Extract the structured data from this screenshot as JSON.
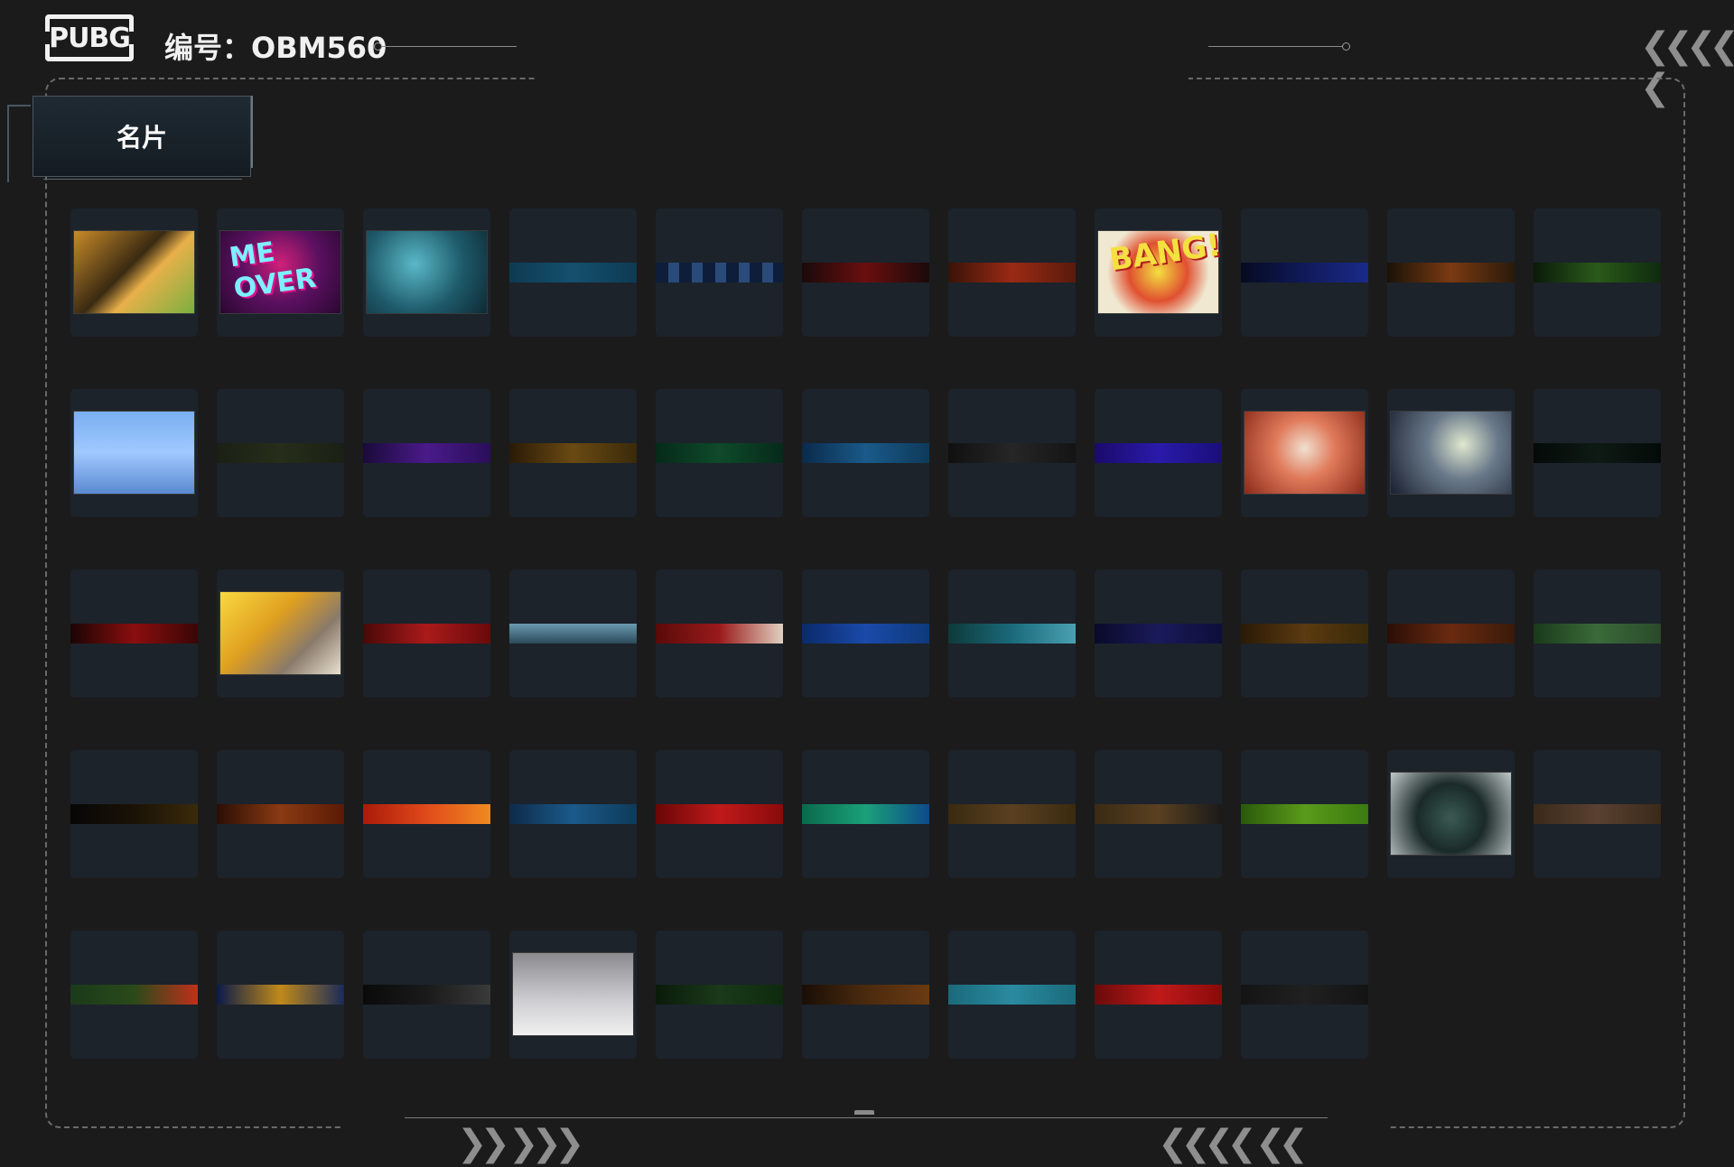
{
  "header": {
    "logo_text": "PUBG",
    "title": "编号：OBM560"
  },
  "tab": {
    "label": "名片"
  },
  "colors": {
    "background": "#1b1b1c",
    "card": "#1c232b",
    "frame": "#6a6a6a"
  },
  "cards": [
    {
      "kind": "art",
      "fill": "linear-gradient(135deg,#c98b2a,#3a2a12 45%,#e8b04a 60%,#7ab040)"
    },
    {
      "kind": "art",
      "fill": "radial-gradient(circle at 50% 40%,#d0207a,#5a1060 50%,#2a0830)",
      "label": "ME OVER"
    },
    {
      "kind": "art",
      "fill": "radial-gradient(circle at 40% 40%,#5ab8c8,#1e5a6a 55%,#0e2a34)"
    },
    {
      "kind": "strip",
      "fill": "linear-gradient(90deg,#0e3a52,#14506e,#0e3a52)"
    },
    {
      "kind": "strip",
      "fill": "repeating-linear-gradient(90deg,#0e1e3a 0 14px,#2a4a7a 14px 26px)"
    },
    {
      "kind": "strip",
      "fill": "linear-gradient(90deg,#1a0a0a,#6a0e0e,#1a0a0a)"
    },
    {
      "kind": "strip",
      "fill": "linear-gradient(90deg,#3a1208,#9a2a14,#5a1a0c)"
    },
    {
      "kind": "art",
      "fill": "radial-gradient(circle at 50% 50%,#f4e040,#e05030 40%,#f0e8d0 70%)",
      "label": "BANG!"
    },
    {
      "kind": "strip",
      "fill": "linear-gradient(90deg,#060a20,#101a5a,#1a2a8a)"
    },
    {
      "kind": "strip",
      "fill": "linear-gradient(90deg,#1a1208,#7a3a12,#2a1a0a)"
    },
    {
      "kind": "strip",
      "fill": "linear-gradient(90deg,#0a1a0a,#2a5a1a,#0e2a0e)"
    },
    {
      "kind": "art",
      "fill": "linear-gradient(180deg,#7ab0f0,#a0c8ff 50%,#5a8ad0)"
    },
    {
      "kind": "strip",
      "fill": "linear-gradient(90deg,#1a2014,#262e1a,#1a2014)"
    },
    {
      "kind": "strip",
      "fill": "linear-gradient(90deg,#1a0a3a,#4a1a8a,#2a0e5a)"
    },
    {
      "kind": "strip",
      "fill": "linear-gradient(90deg,#2a1a06,#6a4a12,#3a2a0a)"
    },
    {
      "kind": "strip",
      "fill": "linear-gradient(90deg,#062a1a,#0e4a2a,#062a1a)"
    },
    {
      "kind": "strip",
      "fill": "linear-gradient(90deg,#0a2a4a,#1a5a8a,#0e3a5a)"
    },
    {
      "kind": "strip",
      "fill": "linear-gradient(90deg,#101010,#262626,#141414)"
    },
    {
      "kind": "strip",
      "fill": "linear-gradient(90deg,#1a0a6a,#2a1aaa,#1a0e7a)"
    },
    {
      "kind": "art",
      "fill": "radial-gradient(circle at 50% 45%,#f0e0d0,#e07a5a 40%,#8a2a1a)"
    },
    {
      "kind": "art",
      "fill": "radial-gradient(circle at 60% 40%,#e0e8d0,#6a7a8a 40%,#1a2030)"
    },
    {
      "kind": "strip",
      "fill": "linear-gradient(90deg,#040a08,#0e1a14,#040a08)"
    },
    {
      "kind": "strip",
      "fill": "linear-gradient(90deg,#1a0404,#8a0e0e,#3a0606)"
    },
    {
      "kind": "art",
      "fill": "linear-gradient(135deg,#f8d840,#e0a020 40%,#8a7a6a 70%,#e8e0d0)"
    },
    {
      "kind": "strip",
      "fill": "linear-gradient(90deg,#4a0808,#aa1a1a,#6a0a0a)"
    },
    {
      "kind": "strip",
      "fill": "linear-gradient(180deg,#6a9ab0,#2a4a5a)"
    },
    {
      "kind": "strip",
      "fill": "linear-gradient(90deg,#5a0a0a,#9a1a1a,#e0d0c0)"
    },
    {
      "kind": "strip",
      "fill": "linear-gradient(90deg,#0a2a6a,#1a4aaa,#0e3a7a)"
    },
    {
      "kind": "strip",
      "fill": "linear-gradient(90deg,#0e3a3a,#1a6a7a,#4aa0b0)"
    },
    {
      "kind": "strip",
      "fill": "linear-gradient(90deg,#0a0a2a,#1a1a5a,#0e0e3a)"
    },
    {
      "kind": "strip",
      "fill": "linear-gradient(90deg,#2a1a06,#5a3a10,#3a2a0a)"
    },
    {
      "kind": "strip",
      "fill": "linear-gradient(90deg,#2a0e06,#6a2a10,#3a1a0a)"
    },
    {
      "kind": "strip",
      "fill": "linear-gradient(90deg,#1a3a1a,#3a6a3a,#2a4a2a)"
    },
    {
      "kind": "strip",
      "fill": "linear-gradient(90deg,#060606,#1a1206,#3a2a0a)"
    },
    {
      "kind": "strip",
      "fill": "linear-gradient(90deg,#2a0e04,#8a3a12,#5a1a06)"
    },
    {
      "kind": "strip",
      "fill": "linear-gradient(90deg,#aa1a0a,#e04a1a,#f08a20)"
    },
    {
      "kind": "strip",
      "fill": "linear-gradient(90deg,#0e2a4a,#1a5a8a,#0e3a5a)"
    },
    {
      "kind": "strip",
      "fill": "linear-gradient(90deg,#6a0606,#c01a1a,#8a0a0a)"
    },
    {
      "kind": "strip",
      "fill": "linear-gradient(90deg,#0a6a4a,#1aa07a,#0e4a8a)"
    },
    {
      "kind": "strip",
      "fill": "linear-gradient(90deg,#3a2a10,#5a4020,#3a2a10)"
    },
    {
      "kind": "strip",
      "fill": "linear-gradient(90deg,#3a2a14,#5a4020,#1a1a1a)"
    },
    {
      "kind": "strip",
      "fill": "linear-gradient(90deg,#2a5a0a,#5a9a1a,#3a7a10)"
    },
    {
      "kind": "art",
      "fill": "radial-gradient(circle at 50% 55%,#3a5a52,#1a2a28 45%,#c0c8c8)"
    },
    {
      "kind": "strip",
      "fill": "linear-gradient(90deg,#3a2a1a,#5a4030,#3a2a1a)"
    },
    {
      "kind": "strip",
      "fill": "linear-gradient(90deg,#1a3a1a,#2a4a1a,#c0301a)"
    },
    {
      "kind": "strip",
      "fill": "linear-gradient(90deg,#0a1a4a,#c08a1a,#1a2a5a)"
    },
    {
      "kind": "strip",
      "fill": "linear-gradient(90deg,#0a0a0a,#1a1a1a,#3a3a3a)"
    },
    {
      "kind": "art",
      "fill": "linear-gradient(180deg,#8a8a90,#d0d0d4 60%,#f0f0f0)"
    },
    {
      "kind": "strip",
      "fill": "linear-gradient(90deg,#0a1a0a,#1a3a1a,#0e2a0e)"
    },
    {
      "kind": "strip",
      "fill": "linear-gradient(90deg,#1a0e06,#4a2a0e,#6a3a12)"
    },
    {
      "kind": "strip",
      "fill": "linear-gradient(90deg,#1a6a7a,#2a8aa0,#1a6a7a)"
    },
    {
      "kind": "strip",
      "fill": "linear-gradient(90deg,#6a0a0a,#c01a1a,#8a0a0a)"
    },
    {
      "kind": "strip",
      "fill": "linear-gradient(90deg,#141414,#202020,#141414)"
    }
  ]
}
